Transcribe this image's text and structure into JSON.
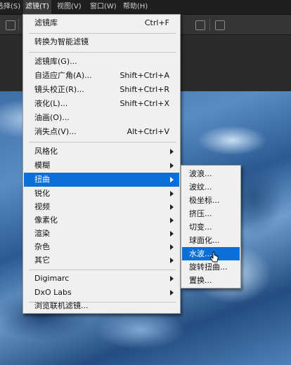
{
  "menubar": {
    "items": [
      {
        "label": "选择(S)"
      },
      {
        "label": "滤镜(T)"
      },
      {
        "label": "视图(V)"
      },
      {
        "label": "窗口(W)"
      },
      {
        "label": "帮助(H)"
      }
    ]
  },
  "filter_menu": {
    "items": [
      {
        "label": "滤镜库",
        "shortcut": "Ctrl+F"
      },
      {
        "label": "转换为智能滤镜",
        "shortcut": ""
      },
      {
        "label": "滤镜库(G)...",
        "shortcut": ""
      },
      {
        "label": "自适应广角(A)...",
        "shortcut": "Shift+Ctrl+A"
      },
      {
        "label": "镜头校正(R)...",
        "shortcut": "Shift+Ctrl+R"
      },
      {
        "label": "液化(L)...",
        "shortcut": "Shift+Ctrl+X"
      },
      {
        "label": "油画(O)...",
        "shortcut": ""
      },
      {
        "label": "消失点(V)...",
        "shortcut": "Alt+Ctrl+V"
      },
      {
        "label": "风格化",
        "submenu": true
      },
      {
        "label": "模糊",
        "submenu": true
      },
      {
        "label": "扭曲",
        "submenu": true
      },
      {
        "label": "锐化",
        "submenu": true
      },
      {
        "label": "视频",
        "submenu": true
      },
      {
        "label": "像素化",
        "submenu": true
      },
      {
        "label": "渲染",
        "submenu": true
      },
      {
        "label": "杂色",
        "submenu": true
      },
      {
        "label": "其它",
        "submenu": true
      },
      {
        "label": "Digimarc",
        "submenu": true
      },
      {
        "label": "DxO Labs",
        "submenu": true
      },
      {
        "label": "浏览联机滤镜..."
      }
    ]
  },
  "distort_submenu": {
    "items": [
      {
        "label": "波浪..."
      },
      {
        "label": "波纹..."
      },
      {
        "label": "极坐标..."
      },
      {
        "label": "挤压..."
      },
      {
        "label": "切变..."
      },
      {
        "label": "球面化..."
      },
      {
        "label": "水波..."
      },
      {
        "label": "旋转扭曲..."
      },
      {
        "label": "置换..."
      }
    ]
  },
  "colors": {
    "highlight": "#0a6fd8",
    "menu_bg": "#f0f0f0",
    "app_bg": "#2b2b2b"
  }
}
